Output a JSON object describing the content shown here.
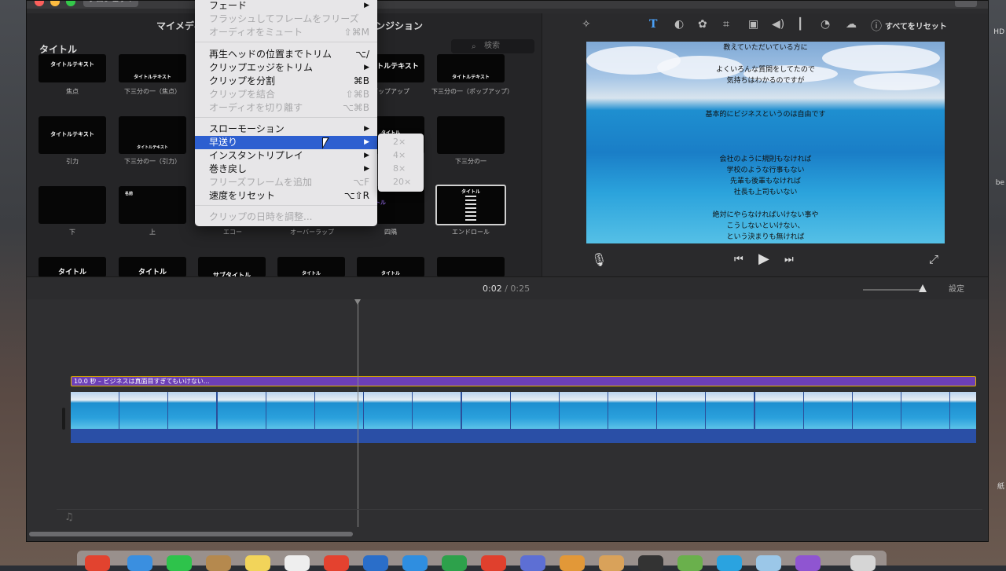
{
  "window": {
    "back_label": "プロジェクト"
  },
  "browser": {
    "tabs": [
      "マイメディア",
      "トランジション"
    ],
    "category_title": "タイトル",
    "search_placeholder": "検索",
    "tiles": [
      {
        "text": "タイトルテキスト",
        "label": "焦点"
      },
      {
        "text": "タイトルテキスト",
        "label": "下三分の一（焦点）"
      },
      {
        "text": "タイトルテキスト",
        "label": "ポップアップ"
      },
      {
        "text": "タイトルテキスト",
        "label": "下三分の一（ポップアップ）"
      },
      {
        "text": "タイトルテキスト",
        "label": "引力"
      },
      {
        "text": "タイトルテキスト",
        "label": "下三分の一（引力）"
      },
      {
        "text": "タイトル",
        "label": ""
      },
      {
        "text": "",
        "label": "下三分の一"
      },
      {
        "text": "",
        "label": "下"
      },
      {
        "text": "名前",
        "label": "上"
      },
      {
        "text": "",
        "label": "エコー"
      },
      {
        "text": "",
        "label": "オーバーラップ"
      },
      {
        "text": "タイトル",
        "label": "四隅"
      },
      {
        "text": "タイトル",
        "label": "エンドロール"
      },
      {
        "text": "タイトル",
        "label": ""
      },
      {
        "text": "タイトル",
        "label": ""
      },
      {
        "text": "サブタイトル",
        "label": ""
      },
      {
        "text": "タイトル",
        "label": ""
      },
      {
        "text": "タイトル",
        "label": ""
      },
      {
        "text": "",
        "label": ""
      }
    ]
  },
  "viewer": {
    "reset_all": "すべてをリセット",
    "lines": [
      "教えていただいている方に",
      "よくいろんな質問をしてたので",
      "気持ちはわかるのですが",
      "基本的にビジネスというのは自由です",
      "会社のように規則もなければ",
      "学校のような行事もない",
      "先輩も後輩もなければ",
      "社長も上司もいない",
      "絶対にやらなければいけない事や",
      "こうしないといけない、",
      "という決まりも無ければ"
    ]
  },
  "timeline": {
    "current": "0:02",
    "separator": "/",
    "total": "0:25",
    "settings": "設定",
    "title_clip": "10.0 秒 – ビジネスは真面目すぎてもいけない..."
  },
  "menu": {
    "items": [
      {
        "label": "フェード",
        "shortcut": "",
        "arrow": "▶",
        "disabled": false
      },
      {
        "label": "フラッシュしてフレームをフリーズ",
        "shortcut": "",
        "arrow": "",
        "disabled": true
      },
      {
        "label": "オーディオをミュート",
        "shortcut": "⇧⌘M",
        "arrow": "",
        "disabled": true
      },
      {
        "label": "再生ヘッドの位置までトリム",
        "shortcut": "⌥/",
        "arrow": "",
        "disabled": false
      },
      {
        "label": "クリップエッジをトリム",
        "shortcut": "",
        "arrow": "▶",
        "disabled": false
      },
      {
        "label": "クリップを分割",
        "shortcut": "⌘B",
        "arrow": "",
        "disabled": false
      },
      {
        "label": "クリップを結合",
        "shortcut": "⇧⌘B",
        "arrow": "",
        "disabled": true
      },
      {
        "label": "オーディオを切り離す",
        "shortcut": "⌥⌘B",
        "arrow": "",
        "disabled": true
      },
      {
        "label": "スローモーション",
        "shortcut": "",
        "arrow": "▶",
        "disabled": false
      },
      {
        "label": "早送り",
        "shortcut": "",
        "arrow": "▶",
        "disabled": false
      },
      {
        "label": "インスタントリプレイ",
        "shortcut": "",
        "arrow": "▶",
        "disabled": false
      },
      {
        "label": "巻き戻し",
        "shortcut": "",
        "arrow": "▶",
        "disabled": false
      },
      {
        "label": "フリーズフレームを追加",
        "shortcut": "⌥F",
        "arrow": "",
        "disabled": true
      },
      {
        "label": "速度をリセット",
        "shortcut": "⌥⇧R",
        "arrow": "",
        "disabled": false
      },
      {
        "label": "クリップの日時を調整...",
        "shortcut": "",
        "arrow": "",
        "disabled": true
      }
    ],
    "submenu": [
      "2×",
      "4×",
      "8×",
      "20×"
    ]
  },
  "desktop": {
    "side_labels": [
      "HD",
      "be",
      "紙"
    ]
  }
}
